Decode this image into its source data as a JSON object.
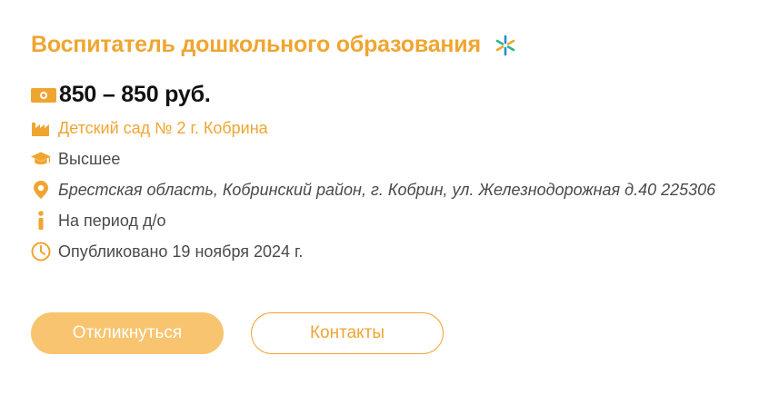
{
  "vacancy": {
    "title": "Воспитатель дошкольного образования",
    "salary": "850 – 850 руб.",
    "company": "Детский сад № 2 г. Кобрина",
    "education": "Высшее",
    "address": "Брестская область, Кобринский район, г. Кобрин, ул. Железнодорожная д.40 225306",
    "term": "На период д/о",
    "published": "Опубликовано 19 ноября 2024 г."
  },
  "actions": {
    "apply_label": "Откликнуться",
    "contacts_label": "Контакты"
  },
  "icons": {
    "favorite": "asterisk-icon",
    "salary": "banknote-icon",
    "company": "factory-icon",
    "education": "graduation-cap-icon",
    "address": "map-pin-icon",
    "term": "info-icon",
    "published": "clock-icon"
  },
  "colors": {
    "accent": "#f0a531",
    "button_fill": "#f8c46f",
    "star_blue": "#1f8fd1",
    "star_green": "#2bb58b",
    "text": "#4a4a4a"
  }
}
